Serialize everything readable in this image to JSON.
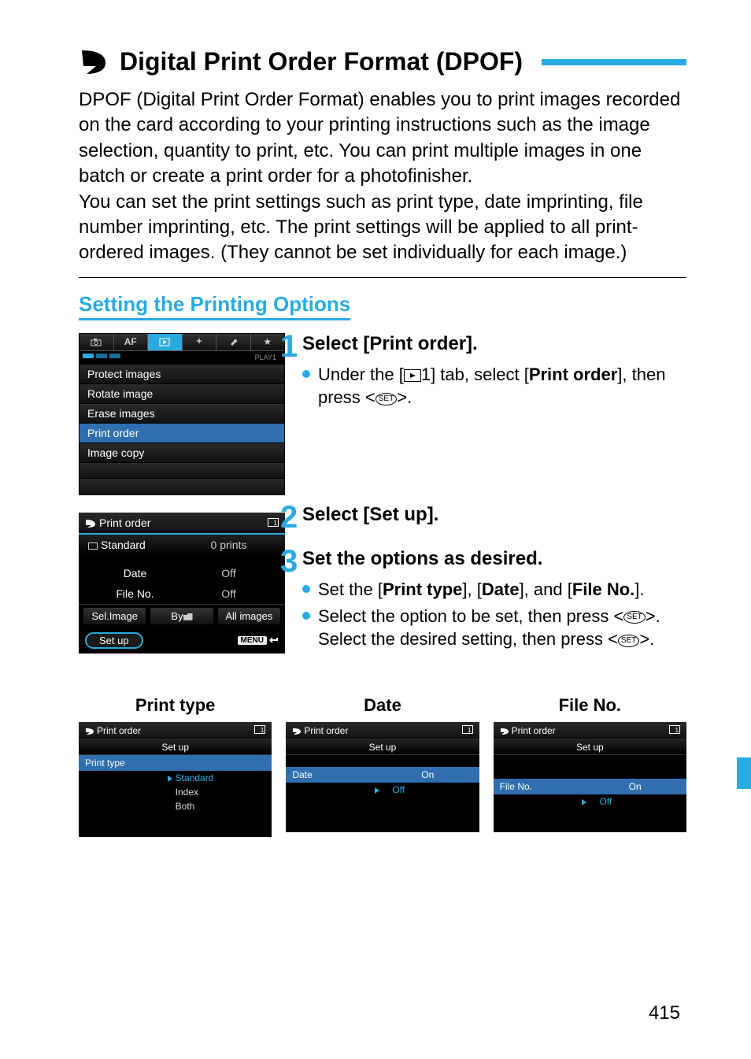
{
  "title": "Digital Print Order Format (DPOF)",
  "intro": {
    "p1": "DPOF (Digital Print Order Format) enables you to print images recorded on the card according to your printing instructions such as the image selection, quantity to print, etc. You can print multiple images in one batch or create a print order for a photofinisher.",
    "p2": "You can set the print settings such as print type, date imprinting, file number imprinting, etc. The print settings will be applied to all print-ordered images. (They cannot be set individually for each image.)"
  },
  "section_title": "Setting the Printing Options",
  "cam_menu": {
    "tab_group_label": "PLAY1",
    "tabs": [
      "camera",
      "AF",
      "play",
      "tool",
      "wrench",
      "star"
    ],
    "items": [
      "Protect images",
      "Rotate image",
      "Erase images",
      "Print order",
      "Image copy"
    ],
    "selected_index": 3
  },
  "print_order_screen": {
    "title": "Print order",
    "type_label": "Standard",
    "prints": "0 prints",
    "rows": [
      {
        "l": "Date",
        "r": "Off"
      },
      {
        "l": "File No.",
        "r": "Off"
      }
    ],
    "buttons": [
      "Sel.Image",
      "By",
      "All images"
    ],
    "setup": "Set up",
    "menu_label": "MENU"
  },
  "steps": [
    {
      "num": "1",
      "title": "Select [Print order].",
      "bullets": [
        {
          "pre": "Under the [",
          "play": true,
          "mid": "1] tab, select [",
          "bold": "Print order",
          "post": "], then press <",
          "set": true,
          "end": ">."
        }
      ]
    },
    {
      "num": "2",
      "title": "Select [Set up]."
    },
    {
      "num": "3",
      "title": "Set the options as desired.",
      "bullets": [
        {
          "pre": "Set the [",
          "bold": "Print type",
          "mid": "], [",
          "bold2": "Date",
          "mid2": "], and [",
          "bold3": "File No.",
          "post": "]."
        },
        {
          "pre": "Select the option to be set, then press <",
          "set": true,
          "mid": ">. Select the desired setting, then press <",
          "set2": true,
          "end": ">."
        }
      ]
    }
  ],
  "minis": {
    "print_type": {
      "col_title": "Print type",
      "head": "Print order",
      "sub": "Set up",
      "row_label": "Print type",
      "options": [
        "Standard",
        "Index",
        "Both"
      ],
      "selected": 0
    },
    "date": {
      "col_title": "Date",
      "head": "Print order",
      "sub": "Set up",
      "row_label": "Date",
      "options": [
        "On",
        "Off"
      ],
      "selected": 1
    },
    "file_no": {
      "col_title": "File No.",
      "head": "Print order",
      "sub": "Set up",
      "row_label": "File No.",
      "options": [
        "On",
        "Off"
      ],
      "selected": 1
    }
  },
  "page_number": "415"
}
